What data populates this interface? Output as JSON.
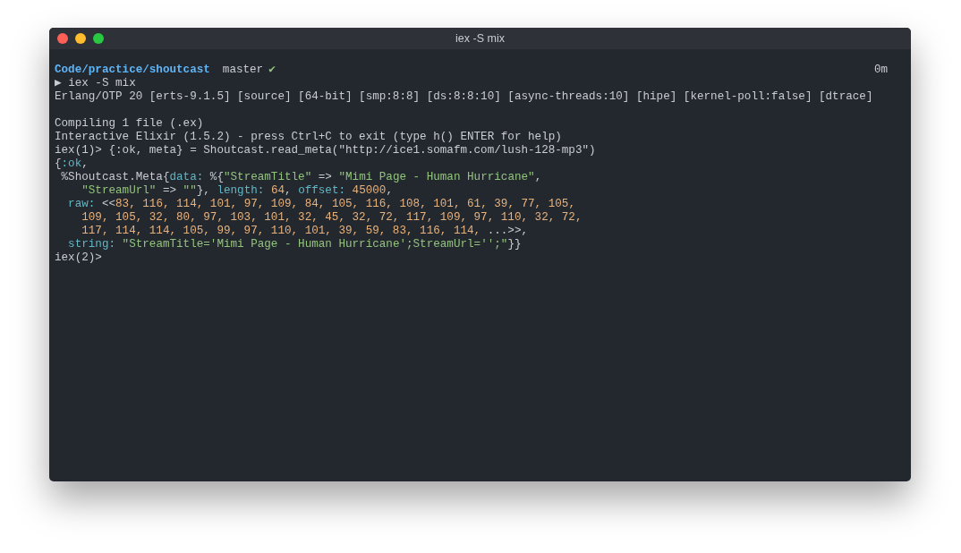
{
  "window": {
    "title": "iex -S mix"
  },
  "prompt": {
    "path": "Code/practice/shoutcast",
    "branch": "master",
    "status_mark": "✔",
    "elapsed": "0m"
  },
  "lines": [
    {
      "kind": "text",
      "segments": [
        {
          "kind": "plain",
          "text": "▶ iex -S mix"
        }
      ]
    },
    {
      "kind": "text",
      "segments": [
        {
          "kind": "plain",
          "text": "Erlang/OTP 20 [erts-9.1.5] [source] [64-bit] [smp:8:8] [ds:8:8:10] [async-threads:10] [hipe] [kernel-poll:false] [dtrace]"
        }
      ]
    },
    {
      "kind": "blank"
    },
    {
      "kind": "text",
      "segments": [
        {
          "kind": "plain",
          "text": "Compiling 1 file (.ex)"
        }
      ]
    },
    {
      "kind": "text",
      "segments": [
        {
          "kind": "plain",
          "text": "Interactive Elixir (1.5.2) - press Ctrl+C to exit (type h() ENTER for help)"
        }
      ]
    },
    {
      "kind": "text",
      "segments": [
        {
          "kind": "plain",
          "text": "iex(1)> {:ok, meta} = Shoutcast.read_meta(\"http://ice1.somafm.com/lush-128-mp3\")"
        }
      ]
    },
    {
      "kind": "text",
      "segments": [
        {
          "kind": "plain",
          "text": "{"
        },
        {
          "kind": "atom",
          "text": ":ok"
        },
        {
          "kind": "plain",
          "text": ","
        }
      ]
    },
    {
      "kind": "text",
      "segments": [
        {
          "kind": "plain",
          "text": " %Shoutcast.Meta{"
        },
        {
          "kind": "atom",
          "text": "data:"
        },
        {
          "kind": "plain",
          "text": " %{"
        },
        {
          "kind": "string",
          "text": "\"StreamTitle\""
        },
        {
          "kind": "plain",
          "text": " => "
        },
        {
          "kind": "string",
          "text": "\"Mimi Page - Human Hurricane\""
        },
        {
          "kind": "plain",
          "text": ","
        }
      ]
    },
    {
      "kind": "text",
      "segments": [
        {
          "kind": "string",
          "text": "    \"StreamUrl\""
        },
        {
          "kind": "plain",
          "text": " => "
        },
        {
          "kind": "string",
          "text": "\"\""
        },
        {
          "kind": "plain",
          "text": "}, "
        },
        {
          "kind": "atom",
          "text": "length:"
        },
        {
          "kind": "number",
          "text": " 64"
        },
        {
          "kind": "plain",
          "text": ", "
        },
        {
          "kind": "atom",
          "text": "offset:"
        },
        {
          "kind": "number",
          "text": " 45000"
        },
        {
          "kind": "plain",
          "text": ","
        }
      ]
    },
    {
      "kind": "text",
      "segments": [
        {
          "kind": "atom",
          "text": "  raw:"
        },
        {
          "kind": "plain",
          "text": " <<"
        },
        {
          "kind": "number",
          "text": "83, 116, 114, 101, 97, 109, 84, 105, 116, 108, 101, 61, 39, 77, 105,"
        }
      ]
    },
    {
      "kind": "text",
      "segments": [
        {
          "kind": "number",
          "text": "    109, 105, 32, 80, 97, 103, 101, 32, 45, 32, 72, 117, 109, 97, 110, 32, 72,"
        }
      ]
    },
    {
      "kind": "text",
      "segments": [
        {
          "kind": "number",
          "text": "    117, 114, 114, 105, 99, 97, 110, 101, 39, 59, 83, 116, 114,"
        },
        {
          "kind": "plain",
          "text": " ...>>,"
        }
      ]
    },
    {
      "kind": "text",
      "segments": [
        {
          "kind": "atom",
          "text": "  string:"
        },
        {
          "kind": "string",
          "text": " \"StreamTitle='Mimi Page - Human Hurricane';StreamUrl='';\""
        },
        {
          "kind": "plain",
          "text": "}}"
        }
      ]
    },
    {
      "kind": "text",
      "segments": [
        {
          "kind": "plain",
          "text": "iex(2)>"
        }
      ]
    }
  ]
}
